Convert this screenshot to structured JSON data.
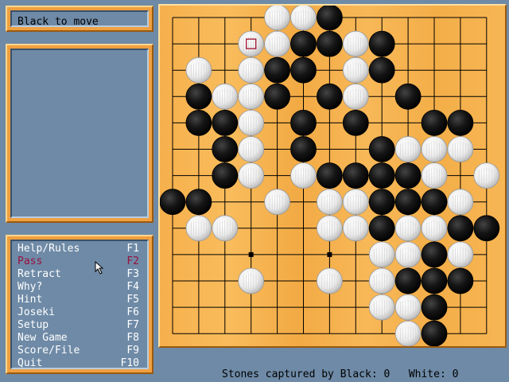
{
  "status": {
    "text": "Black to move"
  },
  "menu": [
    {
      "label": "Help/Rules",
      "key": "F1"
    },
    {
      "label": "Pass",
      "key": "F2",
      "highlight": true
    },
    {
      "label": "Retract",
      "key": "F3"
    },
    {
      "label": "Why?",
      "key": "F4"
    },
    {
      "label": "Hint",
      "key": "F5"
    },
    {
      "label": "Joseki",
      "key": "F6"
    },
    {
      "label": "Setup",
      "key": "F7"
    },
    {
      "label": "New Game",
      "key": "F8"
    },
    {
      "label": "Score/File",
      "key": "F9"
    },
    {
      "label": "Quit",
      "key": "F10"
    }
  ],
  "footer": {
    "captured_black_label": "Stones captured by Black:",
    "captured_black": "0",
    "captured_white_label": "White:",
    "captured_white": "0"
  },
  "board": {
    "size": 13,
    "star_points": [
      [
        3,
        9
      ],
      [
        6,
        9
      ]
    ],
    "last_move": [
      3,
      1
    ],
    "stones": [
      {
        "c": "w",
        "x": 4,
        "y": 0
      },
      {
        "c": "w",
        "x": 5,
        "y": 0
      },
      {
        "c": "b",
        "x": 6,
        "y": 0
      },
      {
        "c": "w",
        "x": 3,
        "y": 1
      },
      {
        "c": "w",
        "x": 4,
        "y": 1
      },
      {
        "c": "b",
        "x": 5,
        "y": 1
      },
      {
        "c": "b",
        "x": 6,
        "y": 1
      },
      {
        "c": "w",
        "x": 7,
        "y": 1
      },
      {
        "c": "b",
        "x": 8,
        "y": 1
      },
      {
        "c": "w",
        "x": 1,
        "y": 2
      },
      {
        "c": "w",
        "x": 3,
        "y": 2
      },
      {
        "c": "b",
        "x": 4,
        "y": 2
      },
      {
        "c": "b",
        "x": 5,
        "y": 2
      },
      {
        "c": "w",
        "x": 7,
        "y": 2
      },
      {
        "c": "b",
        "x": 8,
        "y": 2
      },
      {
        "c": "b",
        "x": 1,
        "y": 3
      },
      {
        "c": "w",
        "x": 2,
        "y": 3
      },
      {
        "c": "w",
        "x": 3,
        "y": 3
      },
      {
        "c": "b",
        "x": 4,
        "y": 3
      },
      {
        "c": "b",
        "x": 6,
        "y": 3
      },
      {
        "c": "w",
        "x": 7,
        "y": 3
      },
      {
        "c": "b",
        "x": 9,
        "y": 3
      },
      {
        "c": "b",
        "x": 1,
        "y": 4
      },
      {
        "c": "b",
        "x": 2,
        "y": 4
      },
      {
        "c": "w",
        "x": 3,
        "y": 4
      },
      {
        "c": "b",
        "x": 5,
        "y": 4
      },
      {
        "c": "b",
        "x": 7,
        "y": 4
      },
      {
        "c": "b",
        "x": 10,
        "y": 4
      },
      {
        "c": "b",
        "x": 11,
        "y": 4
      },
      {
        "c": "b",
        "x": 2,
        "y": 5
      },
      {
        "c": "w",
        "x": 3,
        "y": 5
      },
      {
        "c": "b",
        "x": 5,
        "y": 5
      },
      {
        "c": "b",
        "x": 8,
        "y": 5
      },
      {
        "c": "w",
        "x": 9,
        "y": 5
      },
      {
        "c": "w",
        "x": 10,
        "y": 5
      },
      {
        "c": "w",
        "x": 11,
        "y": 5
      },
      {
        "c": "b",
        "x": 2,
        "y": 6
      },
      {
        "c": "w",
        "x": 3,
        "y": 6
      },
      {
        "c": "w",
        "x": 5,
        "y": 6
      },
      {
        "c": "b",
        "x": 6,
        "y": 6
      },
      {
        "c": "b",
        "x": 7,
        "y": 6
      },
      {
        "c": "b",
        "x": 8,
        "y": 6
      },
      {
        "c": "b",
        "x": 9,
        "y": 6
      },
      {
        "c": "w",
        "x": 10,
        "y": 6
      },
      {
        "c": "w",
        "x": 12,
        "y": 6
      },
      {
        "c": "b",
        "x": 0,
        "y": 7
      },
      {
        "c": "b",
        "x": 1,
        "y": 7
      },
      {
        "c": "w",
        "x": 4,
        "y": 7
      },
      {
        "c": "w",
        "x": 6,
        "y": 7
      },
      {
        "c": "w",
        "x": 7,
        "y": 7
      },
      {
        "c": "b",
        "x": 8,
        "y": 7
      },
      {
        "c": "b",
        "x": 9,
        "y": 7
      },
      {
        "c": "b",
        "x": 10,
        "y": 7
      },
      {
        "c": "w",
        "x": 11,
        "y": 7
      },
      {
        "c": "w",
        "x": 1,
        "y": 8
      },
      {
        "c": "w",
        "x": 2,
        "y": 8
      },
      {
        "c": "w",
        "x": 6,
        "y": 8
      },
      {
        "c": "w",
        "x": 7,
        "y": 8
      },
      {
        "c": "b",
        "x": 8,
        "y": 8
      },
      {
        "c": "w",
        "x": 9,
        "y": 8
      },
      {
        "c": "w",
        "x": 10,
        "y": 8
      },
      {
        "c": "b",
        "x": 11,
        "y": 8
      },
      {
        "c": "b",
        "x": 12,
        "y": 8
      },
      {
        "c": "w",
        "x": 8,
        "y": 9
      },
      {
        "c": "w",
        "x": 9,
        "y": 9
      },
      {
        "c": "b",
        "x": 10,
        "y": 9
      },
      {
        "c": "w",
        "x": 11,
        "y": 9
      },
      {
        "c": "w",
        "x": 3,
        "y": 10
      },
      {
        "c": "w",
        "x": 6,
        "y": 10
      },
      {
        "c": "w",
        "x": 8,
        "y": 10
      },
      {
        "c": "b",
        "x": 9,
        "y": 10
      },
      {
        "c": "b",
        "x": 10,
        "y": 10
      },
      {
        "c": "b",
        "x": 11,
        "y": 10
      },
      {
        "c": "w",
        "x": 8,
        "y": 11
      },
      {
        "c": "w",
        "x": 9,
        "y": 11
      },
      {
        "c": "b",
        "x": 10,
        "y": 11
      },
      {
        "c": "w",
        "x": 9,
        "y": 12
      },
      {
        "c": "b",
        "x": 10,
        "y": 12
      }
    ]
  },
  "colors": {
    "background": "#6e8aa6",
    "panel": "#f0a040",
    "board": "#f6b04c",
    "highlight": "#9a1040"
  }
}
